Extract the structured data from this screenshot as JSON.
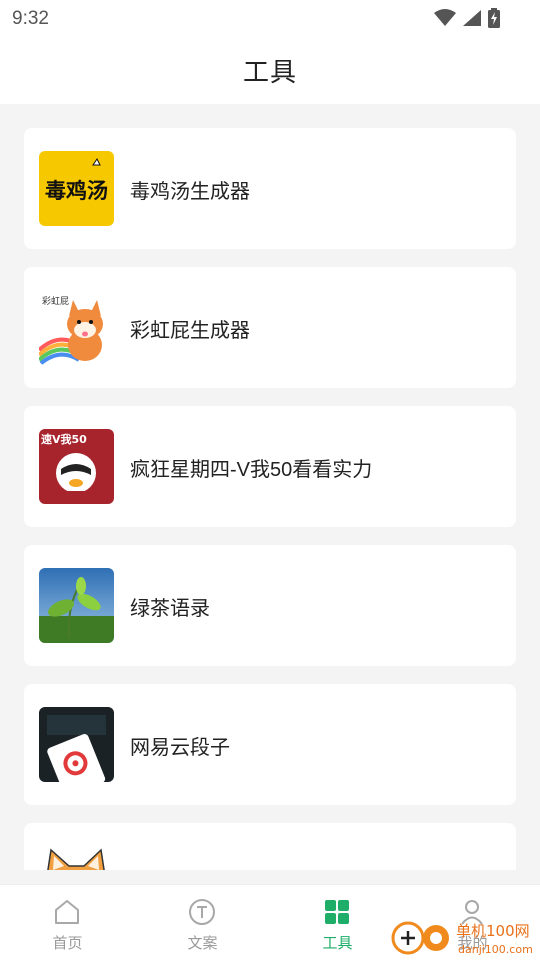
{
  "status_bar": {
    "time": "9:32",
    "icons": [
      "wifi-icon",
      "signal-icon",
      "battery-charging-icon"
    ]
  },
  "header": {
    "title": "工具"
  },
  "tools": [
    {
      "label": "毒鸡汤生成器",
      "thumb_text": "毒鸡汤",
      "icon": "poison-soup-thumbnail"
    },
    {
      "label": "彩虹屁生成器",
      "thumb_text": "彩虹屁",
      "icon": "shiba-rainbow-thumbnail"
    },
    {
      "label": "疯狂星期四-V我50看看实力",
      "thumb_text": "速V我50",
      "icon": "crazy-thursday-thumbnail"
    },
    {
      "label": "绿茶语录",
      "icon": "green-tea-thumbnail"
    },
    {
      "label": "网易云段子",
      "icon": "netease-cloud-thumbnail"
    },
    {
      "label": "",
      "icon": "shiba-thumbnail"
    }
  ],
  "tabbar": {
    "active": "工具",
    "tabs": [
      {
        "label": "首页",
        "icon": "home-icon"
      },
      {
        "label": "文案",
        "icon": "text-icon"
      },
      {
        "label": "工具",
        "icon": "grid-icon"
      },
      {
        "label": "我的",
        "icon": "user-icon"
      }
    ]
  },
  "colors": {
    "accent": "#1fae6a",
    "inactive": "#9a9a9a",
    "background": "#f4f4f4"
  },
  "watermark": {
    "text": "单机100网",
    "url_text": "danji100.com"
  }
}
